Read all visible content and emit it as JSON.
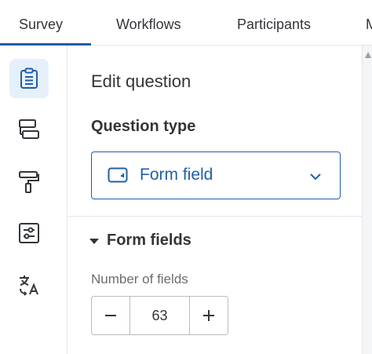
{
  "tabs": [
    {
      "label": "Survey",
      "active": true
    },
    {
      "label": "Workflows",
      "active": false
    },
    {
      "label": "Participants",
      "active": false
    },
    {
      "label": "M",
      "active": false
    }
  ],
  "rail": [
    {
      "icon": "clipboard-icon",
      "active": true
    },
    {
      "icon": "blocks-icon",
      "active": false
    },
    {
      "icon": "paint-roller-icon",
      "active": false
    },
    {
      "icon": "sliders-icon",
      "active": false
    },
    {
      "icon": "translate-icon",
      "active": false
    }
  ],
  "panel": {
    "title": "Edit question",
    "question_type_label": "Question type",
    "question_type_value": "Form field",
    "form_fields_label": "Form fields",
    "number_of_fields_label": "Number of fields",
    "number_of_fields_value": "63"
  },
  "colors": {
    "accent": "#1f5ea8",
    "active_rail_bg": "#e6f0fb"
  }
}
